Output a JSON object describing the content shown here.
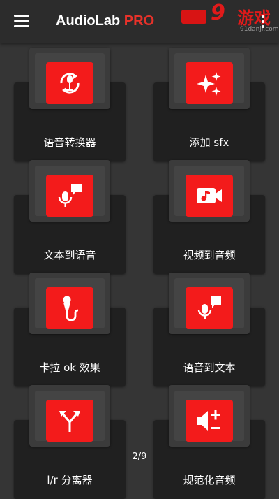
{
  "app": {
    "title_part1": "AudioLab",
    "title_part2": "PRO"
  },
  "watermark": {
    "big": "9",
    "han": "游戏",
    "url": "91danji.com"
  },
  "tiles": [
    {
      "label": "语音转换器",
      "icon": "voice-changer-icon"
    },
    {
      "label": "添加 sfx",
      "icon": "sparkles-icon"
    },
    {
      "label": "文本到语音",
      "icon": "mic-speech-icon"
    },
    {
      "label": "视频到音频",
      "icon": "video-music-icon"
    },
    {
      "label": "卡拉 ok 效果",
      "icon": "karaoke-mic-icon"
    },
    {
      "label": "语音到文本",
      "icon": "mic-bubble-icon"
    },
    {
      "label": "l/r 分离器",
      "icon": "split-arrows-icon"
    },
    {
      "label": "规范化音频",
      "icon": "volume-plus-minus-icon"
    }
  ],
  "pagination": {
    "indicator": "2/9"
  },
  "colors": {
    "accent": "#f31b1b",
    "background": "#353535",
    "card": "#202020"
  }
}
